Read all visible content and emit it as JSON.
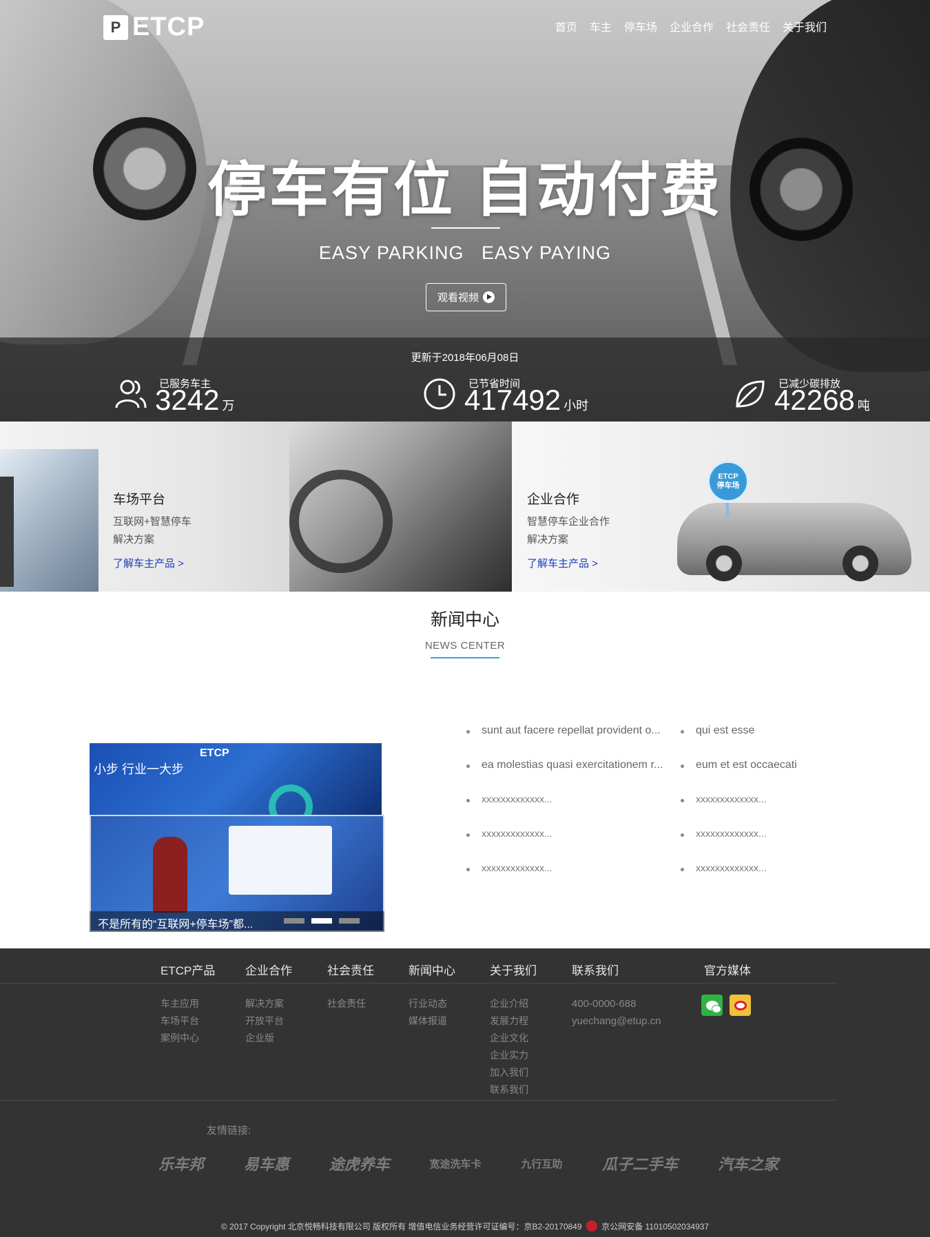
{
  "brand": {
    "logo_mark": "P",
    "logo_text": "ETCP"
  },
  "nav": [
    "首页",
    "车主",
    "停车场",
    "企业合作",
    "社会责任",
    "关于我们"
  ],
  "hero": {
    "title": "停车有位 自动付费",
    "subtitle": "EASY PARKING   EASY PAYING",
    "video_button": "观看视频"
  },
  "stats": {
    "updated": "更新于2018年06月08日",
    "items": [
      {
        "label": "已服务车主",
        "value": "3242",
        "unit": "万",
        "icon": "users-icon"
      },
      {
        "label": "已节省时间",
        "value": "417492",
        "unit": "小时",
        "icon": "clock-icon"
      },
      {
        "label": "已减少碳排放",
        "value": "42268",
        "unit": "吨",
        "icon": "leaf-icon"
      }
    ]
  },
  "panels": [
    {
      "title": "车场平台",
      "desc": "互联网+智慧停车\n解决方案",
      "link": "了解车主产品 >"
    },
    {
      "title": "企业合作",
      "desc": "智慧停车企业合作\n解决方案",
      "link": "了解车主产品 >",
      "pin": "ETCP\n停车场"
    }
  ],
  "news": {
    "title": "新闻中心",
    "title_en": "NEWS CENTER",
    "slide_caption": "不是所有的“互联网+停车场”都...",
    "slide1_text": "小步 行业一大步",
    "slide1_logo": "ETCP",
    "left_items": [
      "sunt aut facere repellat provident o...",
      "ea molestias quasi exercitationem r...",
      "xxxxxxxxxxxxx...",
      "xxxxxxxxxxxxx...",
      "xxxxxxxxxxxxx..."
    ],
    "right_items": [
      "qui est esse",
      "eum et est occaecati",
      "xxxxxxxxxxxxx...",
      "xxxxxxxxxxxxx...",
      "xxxxxxxxxxxxx..."
    ]
  },
  "footer": {
    "columns": [
      {
        "head": "ETCP产品",
        "items": [
          "车主应用",
          "车场平台",
          "案例中心"
        ]
      },
      {
        "head": "企业合作",
        "items": [
          "解决方案",
          "开放平台",
          "企业版"
        ]
      },
      {
        "head": "社会责任",
        "items": [
          "社会责任"
        ]
      },
      {
        "head": "新闻中心",
        "items": [
          "行业动态",
          "媒体报道"
        ]
      },
      {
        "head": "关于我们",
        "items": [
          "企业介绍",
          "发展力程",
          "企业文化",
          "企业实力",
          "加入我们",
          "联系我们"
        ]
      },
      {
        "head": "联系我们",
        "items": [
          "400-0000-688",
          "yuechang@etup.cn"
        ]
      }
    ],
    "media_head": "官方媒体",
    "friends_label": "友情链接:",
    "friends": [
      "乐车邦",
      "易车惠",
      "途虎养车",
      "宽途洗车卡",
      "九行互助",
      "瓜子二手车",
      "汽车之家"
    ],
    "copyright_a": "© 2017 Copyright  北京悦畅科技有限公司  版权所有  增值电信业务经营许可证编号：京B2-20170849",
    "copyright_b": "京公网安备 11010502034937"
  }
}
